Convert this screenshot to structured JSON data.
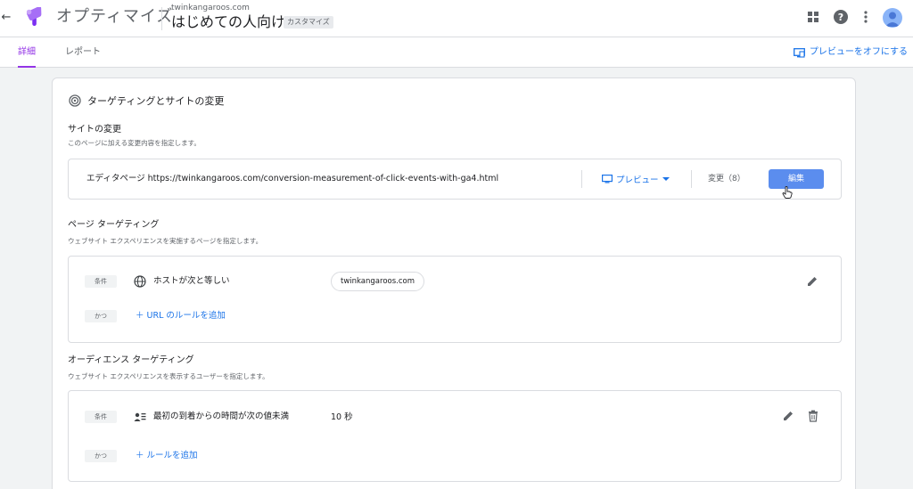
{
  "header": {
    "back_glyph": "←",
    "logo_icon": "optimize-logo",
    "app_name": "オプティマイズ",
    "domain": "twinkangaroos.com",
    "experience_title": "はじめての人向け",
    "experience_type": "カスタマイズ",
    "icons": [
      "apps-grid-icon",
      "help-icon",
      "more-vert-icon",
      "account-avatar"
    ]
  },
  "tabs": [
    {
      "label": "詳細",
      "active": true
    },
    {
      "label": "レポート",
      "active": false
    }
  ],
  "preview_off": {
    "icon": "preview-monitor-icon",
    "label": "プレビューをオフにする"
  },
  "card": {
    "icon": "target-icon",
    "title": "ターゲティングとサイトの変更",
    "site_changes": {
      "title": "サイトの変更",
      "description": "このページに加える変更内容を指定します。",
      "editor_page_label": "エディタページ https://twinkangaroos.com/conversion-measurement-of-click-events-with-ga4.html",
      "preview_label": "プレビュー",
      "changes_label": "変更（8）",
      "edit_label": "編集"
    },
    "page_targeting": {
      "title": "ページ ターゲティング",
      "description": "ウェブサイト エクスペリエンスを実施するページを指定します。",
      "condition_badge": "条件",
      "condition_icon": "globe-icon",
      "condition_text": "ホストが次と等しい",
      "host_value": "twinkangaroos.com",
      "and_badge": "かつ",
      "add_rule_label": "URL のルールを追加"
    },
    "audience_targeting": {
      "title": "オーディエンス ターゲティング",
      "description": "ウェブサイト エクスペリエンスを表示するユーザーを指定します。",
      "condition_badge": "条件",
      "condition_icon": "audience-list-icon",
      "condition_text": "最初の到着からの時間が次の値未満",
      "value": "10 秒",
      "and_badge": "かつ",
      "add_rule_label": "ルールを追加"
    }
  },
  "colors": {
    "accent_purple": "#9334e6",
    "link_blue": "#1a73e8",
    "edit_button": "#5b8dee",
    "background": "#f1f3f4"
  }
}
